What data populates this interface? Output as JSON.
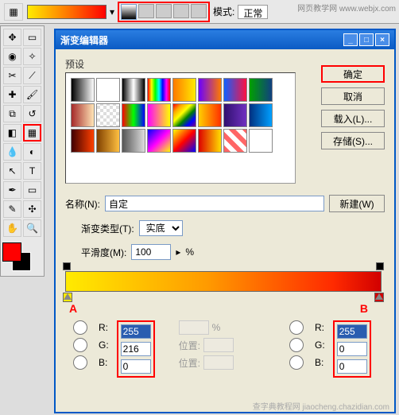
{
  "topbar": {
    "mode_label": "模式:",
    "mode_value": "正常",
    "watermark": "网页教学网 www.webjx.com"
  },
  "dialog": {
    "title": "渐变编辑器",
    "presets_label": "预设",
    "buttons": {
      "ok": "确定",
      "cancel": "取消",
      "load": "载入(L)...",
      "save": "存储(S)...",
      "new": "新建(W)"
    },
    "name_label": "名称(N):",
    "name_value": "自定",
    "type_label": "渐变类型(T):",
    "type_value": "实底",
    "smooth_label": "平滑度(M):",
    "smooth_value": "100",
    "smooth_unit": "%",
    "pos_label": "位置:",
    "stopA_label": "A",
    "stopB_label": "B",
    "rgbA": {
      "r": "255",
      "g": "216",
      "b": "0"
    },
    "rgbB": {
      "r": "255",
      "g": "0",
      "b": "0"
    },
    "rgb_labels": {
      "r": "R:",
      "g": "G:",
      "b": "B:"
    }
  },
  "preset_colors": [
    "linear-gradient(90deg,#000,#fff)",
    "linear-gradient(90deg,#fff,#fff0)",
    "linear-gradient(90deg,#000,#fff,#000)",
    "linear-gradient(90deg,red,yellow,lime,cyan,blue,magenta,red)",
    "linear-gradient(90deg,#ff7a00,#ffeb00)",
    "linear-gradient(90deg,#6a00ff,#ff7a00)",
    "linear-gradient(90deg,#1060ff,#ff1040)",
    "linear-gradient(90deg,#00a000,#104080)",
    "linear-gradient(90deg,#a52a2a,#ffe4b5)",
    "repeating-conic-gradient(#fff 0 25%,#ddd 0 50%) 0/8px 8px",
    "linear-gradient(90deg,#ff0000,#00ff00,#0000ff)",
    "linear-gradient(90deg,magenta,yellow)",
    "linear-gradient(135deg,red,orange,yellow,green,blue,purple)",
    "linear-gradient(90deg,#ffd000,#ff3000)",
    "linear-gradient(90deg,#301070,#7030c0)",
    "linear-gradient(90deg,#003080,#00a0ff)",
    "linear-gradient(90deg,#400000,#ff4000)",
    "linear-gradient(90deg,#804000,#ffc040)",
    "linear-gradient(90deg,#555,#ddd)",
    "linear-gradient(135deg,#00f,#f0f,#ff0)",
    "linear-gradient(135deg,#ff0,#f00,#00f)",
    "linear-gradient(90deg,#d00,#fd0)",
    "repeating-linear-gradient(45deg,#f66 0 6px,#fff 6px 12px)",
    "linear-gradient(90deg,#fff,#fff)"
  ],
  "watermark2": "查字典教程网 jiaocheng.chazidian.com"
}
